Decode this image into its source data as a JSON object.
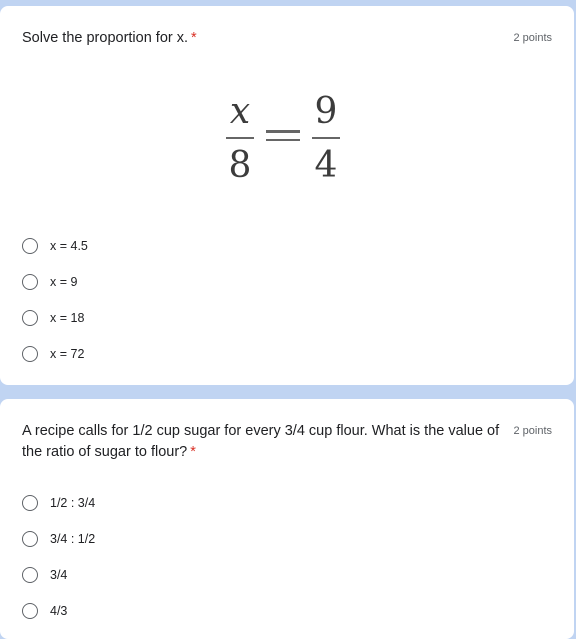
{
  "questions": [
    {
      "title": "Solve the proportion for x.",
      "required_marker": "*",
      "points": "2 points",
      "equation": {
        "left_numerator": "x",
        "left_denominator": "8",
        "operator": "=",
        "right_numerator": "9",
        "right_denominator": "4"
      },
      "options": [
        {
          "label": "x = 4.5",
          "selected": false
        },
        {
          "label": "x = 9",
          "selected": false
        },
        {
          "label": "x = 18",
          "selected": false
        },
        {
          "label": "x = 72",
          "selected": false
        }
      ]
    },
    {
      "title": "A recipe calls for 1/2 cup sugar for every 3/4 cup flour. What is the value of the ratio of sugar to flour?",
      "required_marker": "*",
      "points": "2 points",
      "options": [
        {
          "label": "1/2 : 3/4",
          "selected": false
        },
        {
          "label": "3/4 : 1/2",
          "selected": false
        },
        {
          "label": "3/4",
          "selected": false
        },
        {
          "label": "4/3",
          "selected": false
        }
      ]
    }
  ],
  "colors": {
    "background": "#c0d4f2",
    "card": "#ffffff",
    "required": "#d93025",
    "text": "#202124",
    "muted": "#5f6368"
  }
}
